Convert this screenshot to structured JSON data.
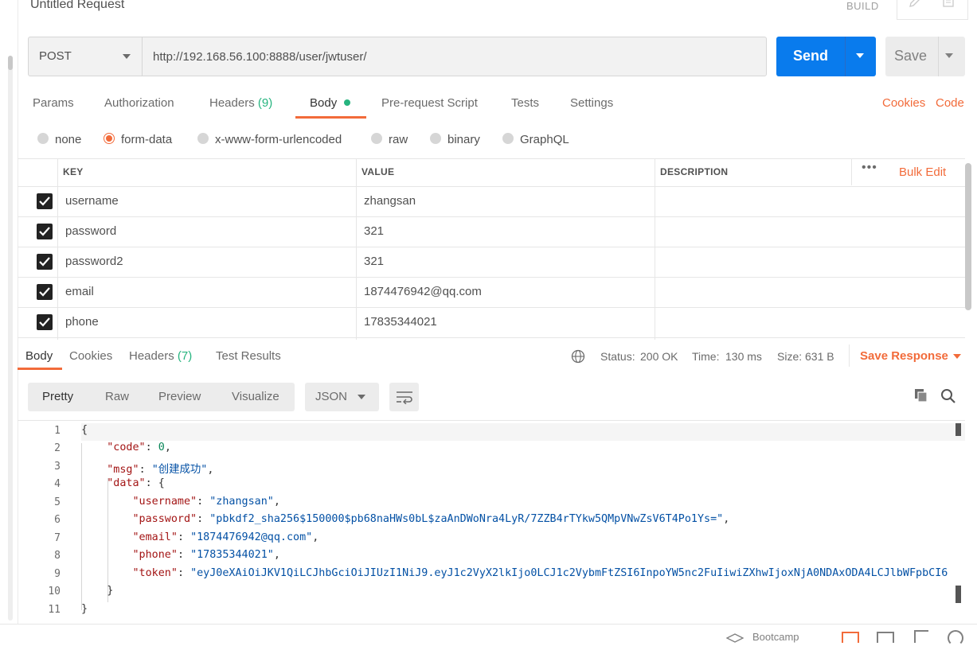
{
  "header": {
    "title": "Untitled Request",
    "build_label": "BUILD"
  },
  "request": {
    "method": "POST",
    "url": "http://192.168.56.100:8888/user/jwtuser/",
    "send_label": "Send",
    "save_label": "Save"
  },
  "tabs": {
    "params": "Params",
    "authorization": "Authorization",
    "headers": "Headers",
    "headers_count": "(9)",
    "body": "Body",
    "pre_request": "Pre-request Script",
    "tests": "Tests",
    "settings": "Settings",
    "cookies": "Cookies",
    "code": "Code"
  },
  "body_types": [
    "none",
    "form-data",
    "x-www-form-urlencoded",
    "raw",
    "binary",
    "GraphQL"
  ],
  "body_type_selected": "form-data",
  "form_table": {
    "columns": {
      "key": "KEY",
      "value": "VALUE",
      "description": "DESCRIPTION"
    },
    "more": "•••",
    "bulk_edit": "Bulk Edit",
    "rows": [
      {
        "key": "username",
        "value": "zhangsan",
        "description": "",
        "checked": true
      },
      {
        "key": "password",
        "value": "321",
        "description": "",
        "checked": true
      },
      {
        "key": "password2",
        "value": "321",
        "description": "",
        "checked": true
      },
      {
        "key": "email",
        "value": "1874476942@qq.com",
        "description": "",
        "checked": true
      },
      {
        "key": "phone",
        "value": "17835344021",
        "description": "",
        "checked": true
      }
    ]
  },
  "response": {
    "tabs": {
      "body": "Body",
      "cookies": "Cookies",
      "headers": "Headers",
      "headers_count": "(7)",
      "test_results": "Test Results"
    },
    "status_label": "Status:",
    "status_value": "200 OK",
    "time_label": "Time:",
    "time_value": "130 ms",
    "size_label": "Size:",
    "size_value": "631 B",
    "save_response": "Save Response",
    "views": [
      "Pretty",
      "Raw",
      "Preview",
      "Visualize"
    ],
    "format": "JSON",
    "line_numbers": [
      "1",
      "2",
      "3",
      "4",
      "5",
      "6",
      "7",
      "8",
      "9",
      "10",
      "11"
    ],
    "json": {
      "code_key": "\"code\"",
      "code_val": "0",
      "msg_key": "\"msg\"",
      "msg_val": "\"创建成功\"",
      "data_key": "\"data\"",
      "username_key": "\"username\"",
      "username_val": "\"zhangsan\"",
      "password_key": "\"password\"",
      "password_val": "\"pbkdf2_sha256$150000$pb68naHWs0bL$zaAnDWoNra4LyR/7ZZB4rTYkw5QMpVNwZsV6T4Po1Ys=\"",
      "email_key": "\"email\"",
      "email_val": "\"1874476942@qq.com\"",
      "phone_key": "\"phone\"",
      "phone_val": "\"17835344021\"",
      "token_key": "\"token\"",
      "token_val": "\"eyJ0eXAiOiJKV1QiLCJhbGciOiJIUzI1NiJ9.eyJ1c2VyX2lkIjo0LCJ1c2VybmFtZSI6InpoYW5nc2FuIiwiZXhwIjoxNjA0NDAxODA4LCJlbWFpbCI6"
    }
  },
  "statusbar": {
    "bootcamp": "Bootcamp"
  }
}
